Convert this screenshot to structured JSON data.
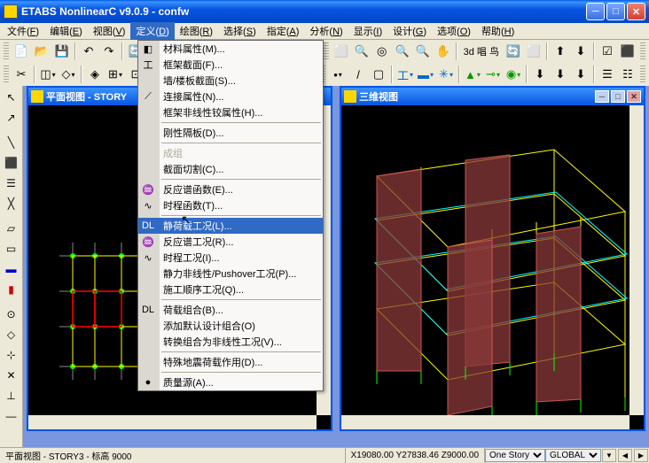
{
  "title": "ETABS NonlinearC v9.0.9 - confw",
  "menu": {
    "items": [
      {
        "label": "文件",
        "key": "F"
      },
      {
        "label": "编辑",
        "key": "E"
      },
      {
        "label": "视图",
        "key": "V"
      },
      {
        "label": "定义",
        "key": "D",
        "open": true
      },
      {
        "label": "绘图",
        "key": "R"
      },
      {
        "label": "选择",
        "key": "S"
      },
      {
        "label": "指定",
        "key": "A"
      },
      {
        "label": "分析",
        "key": "N"
      },
      {
        "label": "显示",
        "key": "I"
      },
      {
        "label": "设计",
        "key": "G"
      },
      {
        "label": "选项",
        "key": "O"
      },
      {
        "label": "帮助",
        "key": "H"
      }
    ]
  },
  "dropdown": {
    "items": [
      {
        "label": "材料属性(M)...",
        "icon": "◧"
      },
      {
        "label": "框架截面(F)...",
        "icon": "工"
      },
      {
        "label": "墙/楼板截面(S)..."
      },
      {
        "label": "连接属性(N)...",
        "icon": "⟋"
      },
      {
        "label": "框架非线性铰属性(H)..."
      },
      {
        "sep": true
      },
      {
        "label": "刚性隔板(D)..."
      },
      {
        "sep": true
      },
      {
        "label": "成组",
        "disabled": true
      },
      {
        "label": "截面切割(C)..."
      },
      {
        "sep": true
      },
      {
        "label": "反应谱函数(E)...",
        "icon": "♒"
      },
      {
        "label": "时程函数(T)...",
        "icon": "∿"
      },
      {
        "sep": true
      },
      {
        "label": "静荷载工况(L)...",
        "icon": "DL",
        "sel": true
      },
      {
        "label": "反应谱工况(R)...",
        "icon": "♒"
      },
      {
        "label": "时程工况(I)...",
        "icon": "∿"
      },
      {
        "label": "静力非线性/Pushover工况(P)..."
      },
      {
        "label": "施工顺序工况(Q)..."
      },
      {
        "sep": true
      },
      {
        "label": "荷载组合(B)...",
        "icon": "DL"
      },
      {
        "label": "添加默认设计组合(O)"
      },
      {
        "label": "转换组合为非线性工况(V)..."
      },
      {
        "sep": true
      },
      {
        "label": "特殊地震荷载作用(D)..."
      },
      {
        "sep": true
      },
      {
        "label": "质量源(A)...",
        "icon": "●"
      }
    ]
  },
  "leftWin": {
    "title": "平面视图 - STORY"
  },
  "rightWin": {
    "title": "三维视图"
  },
  "toolbar2_text": "3d 唱 鸟",
  "status": {
    "leftText": "平面视图 - STORY3 - 标高 9000",
    "coords": "X19080.00  Y27838.46  Z9000.00",
    "storySelect": "One Story",
    "unitSelect": "GLOBAL"
  },
  "icons": {
    "minimize": "─",
    "maximize": "□",
    "close": "✕"
  }
}
